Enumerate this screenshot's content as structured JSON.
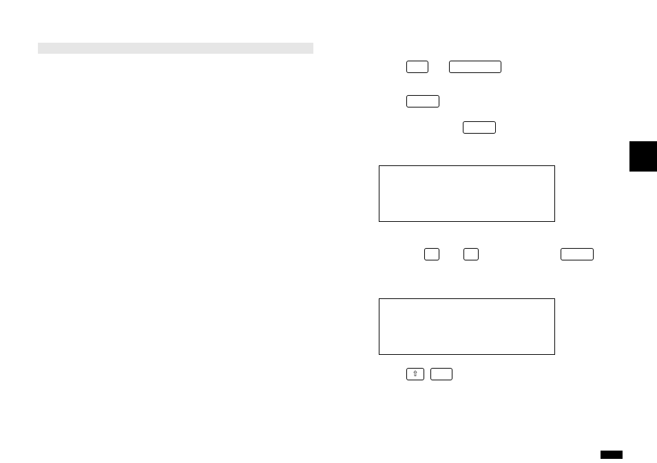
{
  "title_bar_label": "",
  "keys": {
    "r1a": "",
    "r1b": "",
    "r2a": "",
    "r3a": "",
    "r4a": "",
    "r4b": "",
    "r4c": "",
    "shift_glyph": "⇧",
    "r5a": ""
  },
  "lcd1_lines": [
    "",
    "",
    ""
  ],
  "lcd2_lines": [
    "",
    "",
    ""
  ]
}
